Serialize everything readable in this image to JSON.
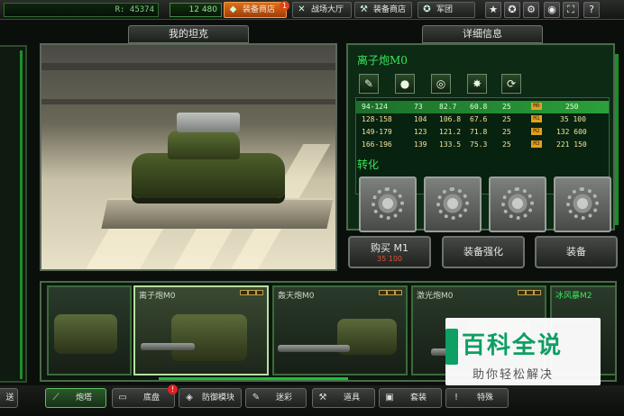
{
  "topbar": {
    "resource": "R: 45374",
    "gold": "12 480",
    "nav": [
      {
        "label": "装备商店",
        "active": true,
        "badge": "1"
      },
      {
        "label": "战场大厅",
        "active": false
      },
      {
        "label": "装备商店",
        "active": false
      },
      {
        "label": "军团",
        "active": false
      }
    ],
    "quick_icons": [
      "star-icon",
      "medal-icon",
      "settings-icon",
      "clock-icon",
      "fullscreen-icon",
      "help-icon"
    ],
    "quick_glyphs": [
      "★",
      "✪",
      "⚙",
      "◉",
      "⛶",
      "?"
    ]
  },
  "panels": {
    "my_tank_header": "我的坦克",
    "details_header": "详细信息"
  },
  "weapon": {
    "name": "离子炮M0",
    "stats": [
      {
        "range": "94-124",
        "a": "73",
        "b": "82.7",
        "c": "60.8",
        "d": "25",
        "lvl": "M0",
        "price": "250"
      },
      {
        "range": "128-158",
        "a": "104",
        "b": "106.8",
        "c": "67.6",
        "d": "25",
        "lvl": "M1",
        "price": "35 100"
      },
      {
        "range": "149-179",
        "a": "123",
        "b": "121.2",
        "c": "71.8",
        "d": "25",
        "lvl": "M2",
        "price": "132 600"
      },
      {
        "range": "166-196",
        "a": "139",
        "b": "133.5",
        "c": "75.3",
        "d": "25",
        "lvl": "M3",
        "price": "221 150"
      }
    ],
    "convert_label": "转化"
  },
  "actions": {
    "buy": "购买 M1",
    "buy_price": "35 100",
    "upgrade": "装备强化",
    "equip": "装备"
  },
  "parts": [
    {
      "label": ""
    },
    {
      "label": "离子炮M0"
    },
    {
      "label": "轰天炮M0"
    },
    {
      "label": "激光炮M0"
    },
    {
      "label": "冰风暴M2"
    }
  ],
  "tabs": [
    {
      "label": "炮塔",
      "active": true
    },
    {
      "label": "底盘",
      "active": false,
      "badge": "!"
    },
    {
      "label": "防御模块",
      "active": false
    },
    {
      "label": "迷彩",
      "active": false
    },
    {
      "label": "道具",
      "active": false
    },
    {
      "label": "套装",
      "active": false
    },
    {
      "label": "特殊",
      "active": false
    }
  ],
  "left_tab_fragment": "送",
  "watermark": {
    "title": "百科全说",
    "subtitle": "助你轻松解决"
  }
}
